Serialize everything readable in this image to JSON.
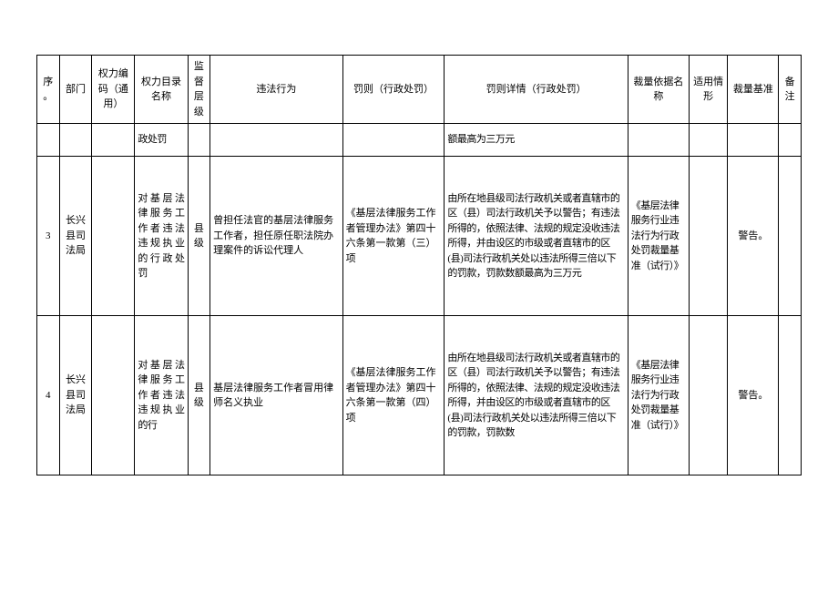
{
  "headers": {
    "seq": "序。",
    "dept": "部门",
    "code": "权力编码（通用）",
    "catalog": "权力目录名称",
    "level": "监督层级",
    "violation": "违法行为",
    "penalty": "罚则（行政处罚）",
    "detail": "罚则详情（行政处罚）",
    "basis": "裁量依据名称",
    "situation": "适用情形",
    "benchmark": "裁量基准",
    "remark": "备注"
  },
  "rows": [
    {
      "seq": "",
      "dept": "",
      "code": "",
      "catalog": "政处罚",
      "level": "",
      "violation": "",
      "penalty": "",
      "detail": "额最高为三万元",
      "basis": "",
      "situation": "",
      "benchmark": "",
      "remark": ""
    },
    {
      "seq": "3",
      "dept": "长兴县司法局",
      "code": "",
      "catalog": "对基层法律服务工作者违法违规执业的行政处罚",
      "level": "县级",
      "violation": "曾担任法官的基层法律服务工作者，担任原任职法院办理案件的诉讼代理人",
      "penalty": "《基层法律服务工作者管理办法》第四十六条第一款第（三）项",
      "detail": "由所在地县级司法行政机关或者直辖市的区（县）司法行政机关予以警告；有违法所得的，依照法律、法规的规定没收违法所得，并由设区的市级或者直辖市的区(县)司法行政机关处以违法所得三倍以下的罚款，罚款数额最高为三万元",
      "basis": "《基层法律服务行业违法行为行政处罚裁量基准（试行）》",
      "situation": "",
      "benchmark": "警告。",
      "remark": ""
    },
    {
      "seq": "4",
      "dept": "长兴县司法局",
      "code": "",
      "catalog": "对基层法律服务工作者违法违规执业的行",
      "level": "县级",
      "violation": "基层法律服务工作者冒用律师名义执业",
      "penalty": "《基层法律服务工作者管理办法》第四十六条第一款第（四）项",
      "detail": "由所在地县级司法行政机关或者直辖市的区（县）司法行政机关予以警告；有违法所得的，依照法律、法规的规定没收违法所得，并由设区的市级或者直辖市的区(县)司法行政机关处以违法所得三倍以下的罚款，罚款数",
      "basis": "《基层法律服务行业违法行为行政处罚裁量基准（试行）》",
      "situation": "",
      "benchmark": "警告。",
      "remark": ""
    }
  ]
}
